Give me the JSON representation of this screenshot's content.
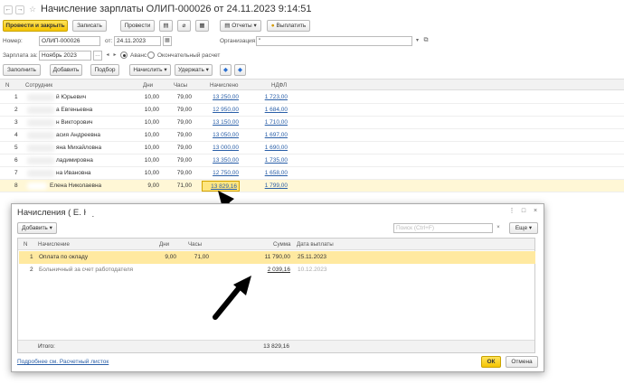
{
  "window": {
    "title": "Начисление зарплаты ОЛИП-000026 от 24.11.2023 9:14:51"
  },
  "toolbar": {
    "post_close": "Провести и закрыть",
    "save": "Записать",
    "post": "Провести",
    "reports": "Отчеты",
    "pay": "Выплатить"
  },
  "form": {
    "number_label": "Номер:",
    "number_value": "ОЛИП-000026",
    "date_label": "от:",
    "date_value": "24.11.2023",
    "org_label": "Организация:",
    "org_value": "\"",
    "period_label": "Зарплата за:",
    "period_value": "Ноябрь 2023",
    "advance_label": "Аванс",
    "final_label": "Окончательный расчет"
  },
  "actions": {
    "fill": "Заполнить",
    "add": "Добавить",
    "select": "Подбор",
    "accrue": "Начислить",
    "withhold": "Удержать"
  },
  "table": {
    "headers": {
      "n": "N",
      "employee": "Сотрудник",
      "days": "Дни",
      "hours": "Часы",
      "accrued": "Начислено",
      "ndfl": "НДФЛ"
    },
    "rows": [
      {
        "n": "1",
        "name": "й Юрьевич",
        "days": "10,00",
        "hours": "79,00",
        "accrued": "13 250,00",
        "ndfl": "1 723,00"
      },
      {
        "n": "2",
        "name": "а Евгеньевна",
        "days": "10,00",
        "hours": "79,00",
        "accrued": "12 950,00",
        "ndfl": "1 684,00"
      },
      {
        "n": "3",
        "name": "н Викторович",
        "days": "10,00",
        "hours": "79,00",
        "accrued": "13 150,00",
        "ndfl": "1 710,00"
      },
      {
        "n": "4",
        "name": "асия Андреевна",
        "days": "10,00",
        "hours": "79,00",
        "accrued": "13 050,00",
        "ndfl": "1 697,00"
      },
      {
        "n": "5",
        "name": "яна Михайловна",
        "days": "10,00",
        "hours": "79,00",
        "accrued": "13 000,00",
        "ndfl": "1 690,00"
      },
      {
        "n": "6",
        "name": "ладимировна",
        "days": "10,00",
        "hours": "79,00",
        "accrued": "13 350,00",
        "ndfl": "1 735,00"
      },
      {
        "n": "7",
        "name": "на Ивановна",
        "days": "10,00",
        "hours": "79,00",
        "accrued": "12 750,00",
        "ndfl": "1 658,00"
      },
      {
        "n": "8",
        "name": "Елена Николаевна",
        "days": "9,00",
        "hours": "71,00",
        "accrued": "13 829,16",
        "ndfl": "1 799,00"
      }
    ]
  },
  "dialog": {
    "title": "Начисления (              Е. Н.)",
    "add": "Добавить",
    "search_placeholder": "Поиск (Ctrl+F)",
    "more": "Еще",
    "headers": {
      "n": "N",
      "accrual": "Начисление",
      "days": "Дни",
      "hours": "Часы",
      "sum": "Сумма",
      "pay_date": "Дата выплаты"
    },
    "rows": [
      {
        "n": "1",
        "accrual": "Оплата по окладу",
        "days": "9,00",
        "hours": "71,00",
        "sum": "11 790,00",
        "pay_date": "25.11.2023"
      },
      {
        "n": "2",
        "accrual": "Больничный за счет работодателя",
        "days": "",
        "hours": "",
        "sum": "2 039,16",
        "pay_date": "10.12.2023"
      }
    ],
    "total_label": "Итого:",
    "total_value": "13 829,16",
    "payslip_link": "Подробнее см. Расчетный листок",
    "ok": "ОК",
    "cancel": "Отмена"
  }
}
